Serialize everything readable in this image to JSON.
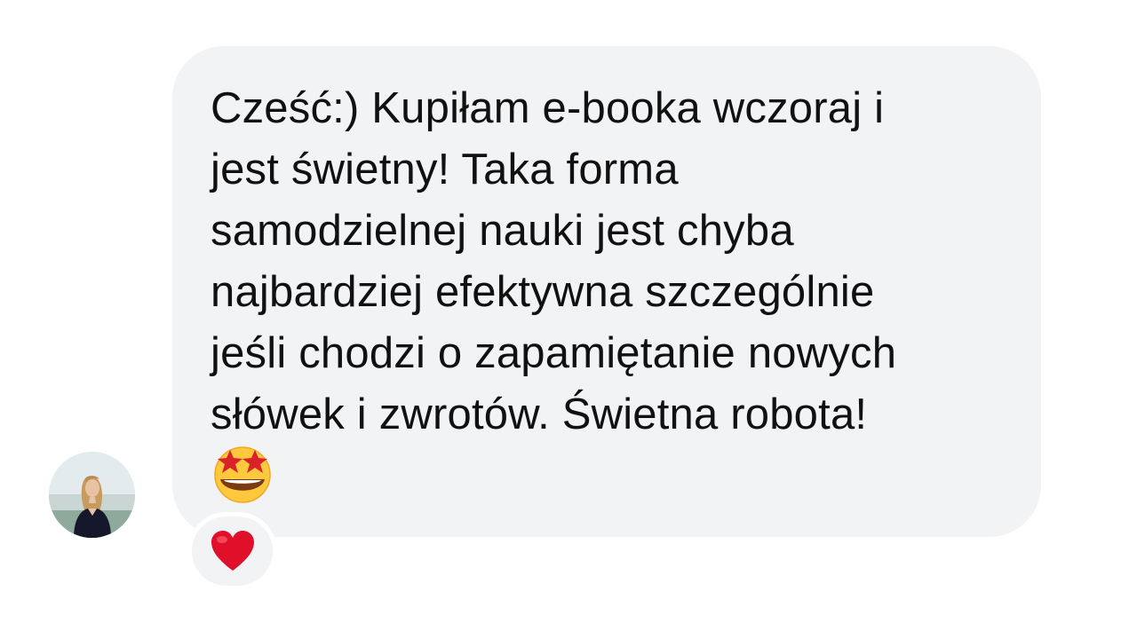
{
  "message": {
    "text": "Cześć:) Kupiłam e-booka wczoraj i\njest świetny! Taka forma\nsamodzielnej nauki jest chyba\nnajbardziej efektywna szczególnie\njeśli chodzi o zapamiętanie nowych\nsłówek i zwrotów. Świetna robota!",
    "emoji": "star-struck-emoji",
    "reaction": "red-heart-icon"
  },
  "colors": {
    "bubble": "#f2f3f5",
    "text": "#111111",
    "heart": "#e0102a",
    "emoji_face": "#ffc83d"
  }
}
